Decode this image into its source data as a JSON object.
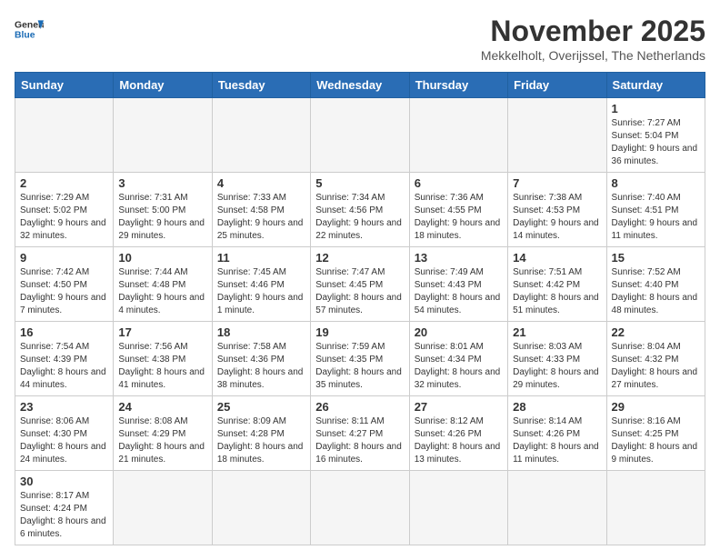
{
  "header": {
    "logo_general": "General",
    "logo_blue": "Blue",
    "month": "November 2025",
    "location": "Mekkelholt, Overijssel, The Netherlands"
  },
  "weekdays": [
    "Sunday",
    "Monday",
    "Tuesday",
    "Wednesday",
    "Thursday",
    "Friday",
    "Saturday"
  ],
  "weeks": [
    [
      {
        "day": "",
        "info": ""
      },
      {
        "day": "",
        "info": ""
      },
      {
        "day": "",
        "info": ""
      },
      {
        "day": "",
        "info": ""
      },
      {
        "day": "",
        "info": ""
      },
      {
        "day": "",
        "info": ""
      },
      {
        "day": "1",
        "info": "Sunrise: 7:27 AM\nSunset: 5:04 PM\nDaylight: 9 hours\nand 36 minutes."
      }
    ],
    [
      {
        "day": "2",
        "info": "Sunrise: 7:29 AM\nSunset: 5:02 PM\nDaylight: 9 hours\nand 32 minutes."
      },
      {
        "day": "3",
        "info": "Sunrise: 7:31 AM\nSunset: 5:00 PM\nDaylight: 9 hours\nand 29 minutes."
      },
      {
        "day": "4",
        "info": "Sunrise: 7:33 AM\nSunset: 4:58 PM\nDaylight: 9 hours\nand 25 minutes."
      },
      {
        "day": "5",
        "info": "Sunrise: 7:34 AM\nSunset: 4:56 PM\nDaylight: 9 hours\nand 22 minutes."
      },
      {
        "day": "6",
        "info": "Sunrise: 7:36 AM\nSunset: 4:55 PM\nDaylight: 9 hours\nand 18 minutes."
      },
      {
        "day": "7",
        "info": "Sunrise: 7:38 AM\nSunset: 4:53 PM\nDaylight: 9 hours\nand 14 minutes."
      },
      {
        "day": "8",
        "info": "Sunrise: 7:40 AM\nSunset: 4:51 PM\nDaylight: 9 hours\nand 11 minutes."
      }
    ],
    [
      {
        "day": "9",
        "info": "Sunrise: 7:42 AM\nSunset: 4:50 PM\nDaylight: 9 hours\nand 7 minutes."
      },
      {
        "day": "10",
        "info": "Sunrise: 7:44 AM\nSunset: 4:48 PM\nDaylight: 9 hours\nand 4 minutes."
      },
      {
        "day": "11",
        "info": "Sunrise: 7:45 AM\nSunset: 4:46 PM\nDaylight: 9 hours\nand 1 minute."
      },
      {
        "day": "12",
        "info": "Sunrise: 7:47 AM\nSunset: 4:45 PM\nDaylight: 8 hours\nand 57 minutes."
      },
      {
        "day": "13",
        "info": "Sunrise: 7:49 AM\nSunset: 4:43 PM\nDaylight: 8 hours\nand 54 minutes."
      },
      {
        "day": "14",
        "info": "Sunrise: 7:51 AM\nSunset: 4:42 PM\nDaylight: 8 hours\nand 51 minutes."
      },
      {
        "day": "15",
        "info": "Sunrise: 7:52 AM\nSunset: 4:40 PM\nDaylight: 8 hours\nand 48 minutes."
      }
    ],
    [
      {
        "day": "16",
        "info": "Sunrise: 7:54 AM\nSunset: 4:39 PM\nDaylight: 8 hours\nand 44 minutes."
      },
      {
        "day": "17",
        "info": "Sunrise: 7:56 AM\nSunset: 4:38 PM\nDaylight: 8 hours\nand 41 minutes."
      },
      {
        "day": "18",
        "info": "Sunrise: 7:58 AM\nSunset: 4:36 PM\nDaylight: 8 hours\nand 38 minutes."
      },
      {
        "day": "19",
        "info": "Sunrise: 7:59 AM\nSunset: 4:35 PM\nDaylight: 8 hours\nand 35 minutes."
      },
      {
        "day": "20",
        "info": "Sunrise: 8:01 AM\nSunset: 4:34 PM\nDaylight: 8 hours\nand 32 minutes."
      },
      {
        "day": "21",
        "info": "Sunrise: 8:03 AM\nSunset: 4:33 PM\nDaylight: 8 hours\nand 29 minutes."
      },
      {
        "day": "22",
        "info": "Sunrise: 8:04 AM\nSunset: 4:32 PM\nDaylight: 8 hours\nand 27 minutes."
      }
    ],
    [
      {
        "day": "23",
        "info": "Sunrise: 8:06 AM\nSunset: 4:30 PM\nDaylight: 8 hours\nand 24 minutes."
      },
      {
        "day": "24",
        "info": "Sunrise: 8:08 AM\nSunset: 4:29 PM\nDaylight: 8 hours\nand 21 minutes."
      },
      {
        "day": "25",
        "info": "Sunrise: 8:09 AM\nSunset: 4:28 PM\nDaylight: 8 hours\nand 18 minutes."
      },
      {
        "day": "26",
        "info": "Sunrise: 8:11 AM\nSunset: 4:27 PM\nDaylight: 8 hours\nand 16 minutes."
      },
      {
        "day": "27",
        "info": "Sunrise: 8:12 AM\nSunset: 4:26 PM\nDaylight: 8 hours\nand 13 minutes."
      },
      {
        "day": "28",
        "info": "Sunrise: 8:14 AM\nSunset: 4:26 PM\nDaylight: 8 hours\nand 11 minutes."
      },
      {
        "day": "29",
        "info": "Sunrise: 8:16 AM\nSunset: 4:25 PM\nDaylight: 8 hours\nand 9 minutes."
      }
    ],
    [
      {
        "day": "30",
        "info": "Sunrise: 8:17 AM\nSunset: 4:24 PM\nDaylight: 8 hours\nand 6 minutes."
      },
      {
        "day": "",
        "info": ""
      },
      {
        "day": "",
        "info": ""
      },
      {
        "day": "",
        "info": ""
      },
      {
        "day": "",
        "info": ""
      },
      {
        "day": "",
        "info": ""
      },
      {
        "day": "",
        "info": ""
      }
    ]
  ]
}
